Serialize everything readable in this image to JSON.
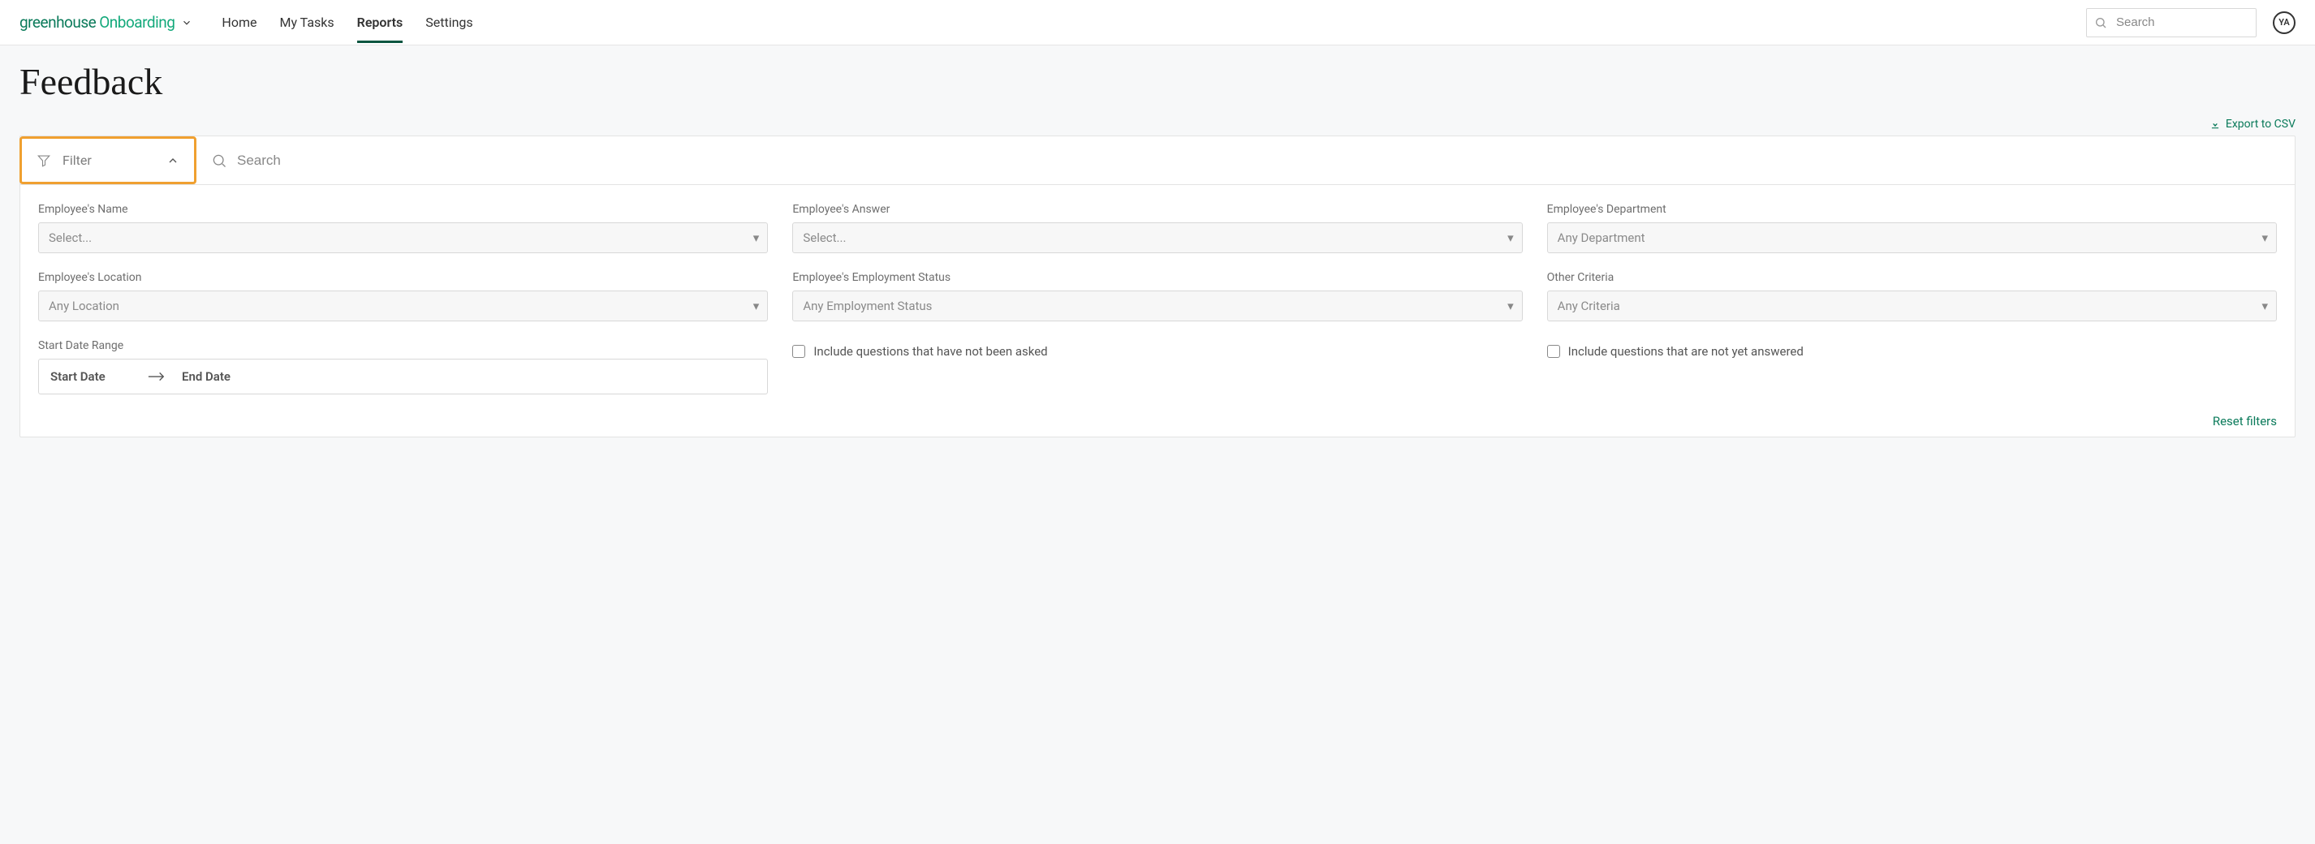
{
  "header": {
    "logo_part1": "greenhouse",
    "logo_part2": "Onboarding",
    "nav": [
      "Home",
      "My Tasks",
      "Reports",
      "Settings"
    ],
    "active_nav_index": 2,
    "search_placeholder": "Search",
    "avatar_initials": "YA"
  },
  "page": {
    "title": "Feedback",
    "export_label": "Export to CSV"
  },
  "filter_panel": {
    "filter_label": "Filter",
    "search_placeholder": "Search",
    "groups": {
      "employee_name": {
        "label": "Employee's Name",
        "placeholder": "Select..."
      },
      "employee_answer": {
        "label": "Employee's Answer",
        "placeholder": "Select..."
      },
      "employee_department": {
        "label": "Employee's Department",
        "placeholder": "Any Department"
      },
      "employee_location": {
        "label": "Employee's Location",
        "placeholder": "Any Location"
      },
      "employment_status": {
        "label": "Employee's Employment Status",
        "placeholder": "Any Employment Status"
      },
      "other_criteria": {
        "label": "Other Criteria",
        "placeholder": "Any Criteria"
      },
      "start_date_range": {
        "label": "Start Date Range",
        "start": "Start Date",
        "end": "End Date"
      }
    },
    "checkboxes": {
      "not_asked": "Include questions that have not been asked",
      "not_answered": "Include questions that are not yet answered"
    },
    "reset_label": "Reset filters"
  }
}
